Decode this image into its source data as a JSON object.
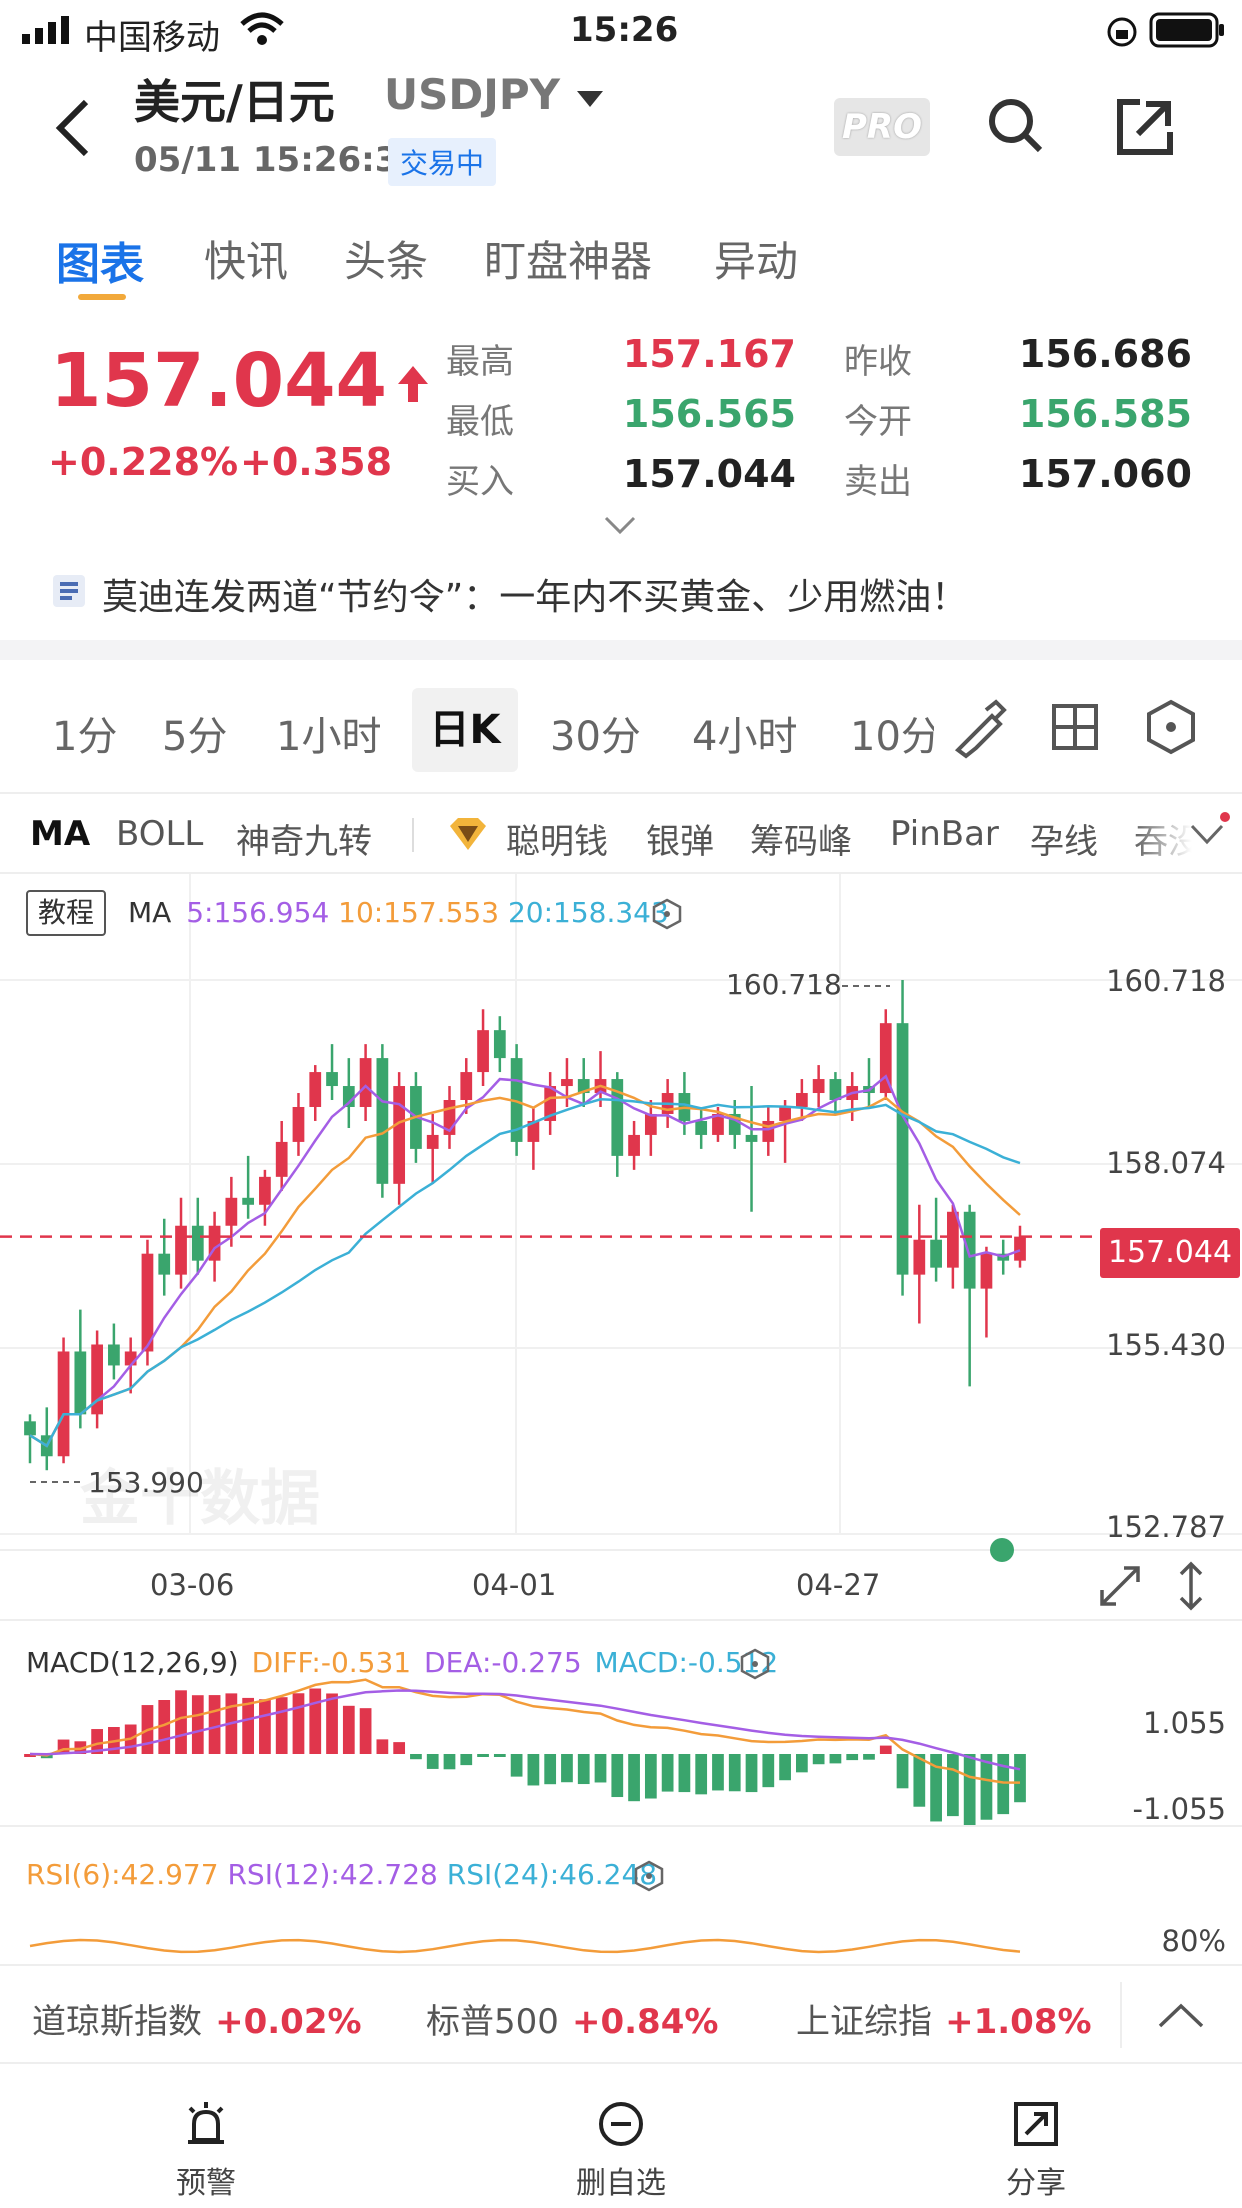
{
  "status_bar": {
    "carrier": "中国移动",
    "time": "15:26"
  },
  "header": {
    "title_cn": "美元/日元",
    "symbol": "USDJPY",
    "timestamp": "05/11 15:26:34",
    "badge": "交易中",
    "pro_label": "PRO"
  },
  "tabs": [
    "图表",
    "快讯",
    "头条",
    "盯盘神器",
    "异动"
  ],
  "quote": {
    "price": "157.044",
    "pct": "+0.228%",
    "chg": "+0.358",
    "high_label": "最高",
    "high": "157.167",
    "low_label": "最低",
    "low": "156.565",
    "bid_label": "买入",
    "bid": "157.044",
    "prev_label": "昨收",
    "prev": "156.686",
    "open_label": "今开",
    "open": "156.585",
    "ask_label": "卖出",
    "ask": "157.060"
  },
  "news": "莫迪连发两道“节约令”：一年内不买黄金、少用燃油！",
  "timeframes": [
    "1分",
    "5分",
    "1小时",
    "日K",
    "30分",
    "4小时",
    "10分"
  ],
  "indicators": [
    "MA",
    "BOLL",
    "神奇九转",
    "聪明钱",
    "银弹",
    "筹码峰",
    "PinBar",
    "孕线",
    "吞没"
  ],
  "chart": {
    "tutorial": "教程",
    "ma_label": "MA",
    "ma5": "5:156.954",
    "ma10": "10:157.553",
    "ma20": "20:158.343",
    "y_ticks": [
      "160.718",
      "158.074",
      "155.430",
      "152.787"
    ],
    "max_label": "160.718",
    "min_label": "153.990",
    "current": "157.044",
    "x_labels": [
      "03-06",
      "04-01",
      "04-27"
    ],
    "watermark": "金十数据"
  },
  "macd": {
    "title": "MACD(12,26,9)",
    "diff": "DIFF:-0.531",
    "dea": "DEA:-0.275",
    "macd": "MACD:-0.512",
    "y_top": "1.055",
    "y_bot": "-1.055"
  },
  "rsi": {
    "r6": "RSI(6):42.977",
    "r12": "RSI(12):42.728",
    "r24": "RSI(24):46.248",
    "y_top": "80%"
  },
  "indices": [
    {
      "name": "道琼斯指数",
      "value": "+0.02%"
    },
    {
      "name": "标普500",
      "value": "+0.84%"
    },
    {
      "name": "上证综指",
      "value": "+1.08%"
    }
  ],
  "bottom_nav": [
    {
      "label": "预警"
    },
    {
      "label": "删自选"
    },
    {
      "label": "分享"
    }
  ],
  "colors": {
    "up": "#e0364c",
    "down": "#3aa56d",
    "accent": "#1a73e8",
    "ma5": "#a45ee5",
    "ma10": "#f39c3a",
    "ma20": "#3bb0d6"
  },
  "chart_data": {
    "type": "candlestick",
    "y_axis": [
      152.787,
      160.718
    ],
    "candles": [
      [
        154.4,
        154.5,
        153.8,
        154.2
      ],
      [
        154.2,
        154.6,
        153.7,
        153.9
      ],
      [
        153.9,
        155.6,
        153.8,
        155.4
      ],
      [
        155.4,
        156.0,
        154.3,
        154.5
      ],
      [
        154.5,
        155.7,
        154.3,
        155.5
      ],
      [
        155.5,
        155.8,
        155.0,
        155.2
      ],
      [
        155.2,
        155.6,
        154.8,
        155.4
      ],
      [
        155.4,
        157.0,
        155.2,
        156.8
      ],
      [
        156.8,
        157.3,
        156.2,
        156.5
      ],
      [
        156.5,
        157.6,
        156.3,
        157.2
      ],
      [
        157.2,
        157.6,
        156.5,
        156.7
      ],
      [
        156.7,
        157.4,
        156.4,
        157.2
      ],
      [
        157.2,
        157.9,
        156.9,
        157.6
      ],
      [
        157.6,
        158.2,
        157.3,
        157.5
      ],
      [
        157.5,
        158.0,
        157.2,
        157.9
      ],
      [
        157.9,
        158.7,
        157.7,
        158.4
      ],
      [
        158.4,
        159.1,
        158.2,
        158.9
      ],
      [
        158.9,
        159.5,
        158.7,
        159.4
      ],
      [
        159.4,
        159.8,
        159.0,
        159.2
      ],
      [
        159.2,
        159.6,
        158.6,
        158.9
      ],
      [
        158.9,
        159.8,
        158.7,
        159.6
      ],
      [
        159.6,
        159.8,
        157.6,
        157.8
      ],
      [
        157.8,
        159.4,
        157.5,
        159.2
      ],
      [
        159.2,
        159.4,
        158.1,
        158.3
      ],
      [
        158.3,
        158.8,
        157.8,
        158.5
      ],
      [
        158.5,
        159.2,
        158.3,
        159.0
      ],
      [
        159.0,
        159.6,
        158.8,
        159.4
      ],
      [
        159.4,
        160.3,
        159.2,
        160.0
      ],
      [
        160.0,
        160.2,
        159.4,
        159.6
      ],
      [
        159.6,
        159.8,
        158.2,
        158.4
      ],
      [
        158.4,
        158.9,
        158.0,
        158.7
      ],
      [
        158.7,
        159.4,
        158.5,
        159.2
      ],
      [
        159.2,
        159.6,
        158.9,
        159.3
      ],
      [
        159.3,
        159.6,
        158.9,
        159.1
      ],
      [
        159.1,
        159.7,
        158.9,
        159.3
      ],
      [
        159.3,
        159.4,
        157.9,
        158.2
      ],
      [
        158.2,
        158.7,
        158.0,
        158.5
      ],
      [
        158.5,
        159.0,
        158.2,
        158.8
      ],
      [
        158.8,
        159.3,
        158.6,
        159.1
      ],
      [
        159.1,
        159.4,
        158.5,
        158.7
      ],
      [
        158.7,
        158.9,
        158.3,
        158.5
      ],
      [
        158.5,
        158.9,
        158.4,
        158.8
      ],
      [
        158.8,
        159.0,
        158.3,
        158.5
      ],
      [
        158.5,
        159.2,
        157.4,
        158.4
      ],
      [
        158.4,
        158.9,
        158.2,
        158.7
      ],
      [
        158.7,
        159.0,
        158.1,
        158.9
      ],
      [
        158.9,
        159.3,
        158.7,
        159.1
      ],
      [
        159.1,
        159.5,
        158.9,
        159.3
      ],
      [
        159.3,
        159.4,
        158.8,
        159.0
      ],
      [
        159.0,
        159.4,
        158.7,
        159.2
      ],
      [
        159.2,
        159.6,
        158.9,
        159.1
      ],
      [
        159.1,
        160.3,
        159.0,
        160.1
      ],
      [
        160.1,
        160.718,
        156.2,
        156.5
      ],
      [
        156.5,
        157.5,
        155.8,
        157.0
      ],
      [
        157.0,
        157.6,
        156.4,
        156.6
      ],
      [
        156.6,
        157.5,
        156.3,
        157.4
      ],
      [
        157.4,
        157.5,
        154.9,
        156.3
      ],
      [
        156.3,
        156.9,
        155.6,
        156.8
      ],
      [
        156.8,
        157.0,
        156.5,
        156.7
      ],
      [
        156.7,
        157.2,
        156.6,
        157.044
      ]
    ]
  }
}
